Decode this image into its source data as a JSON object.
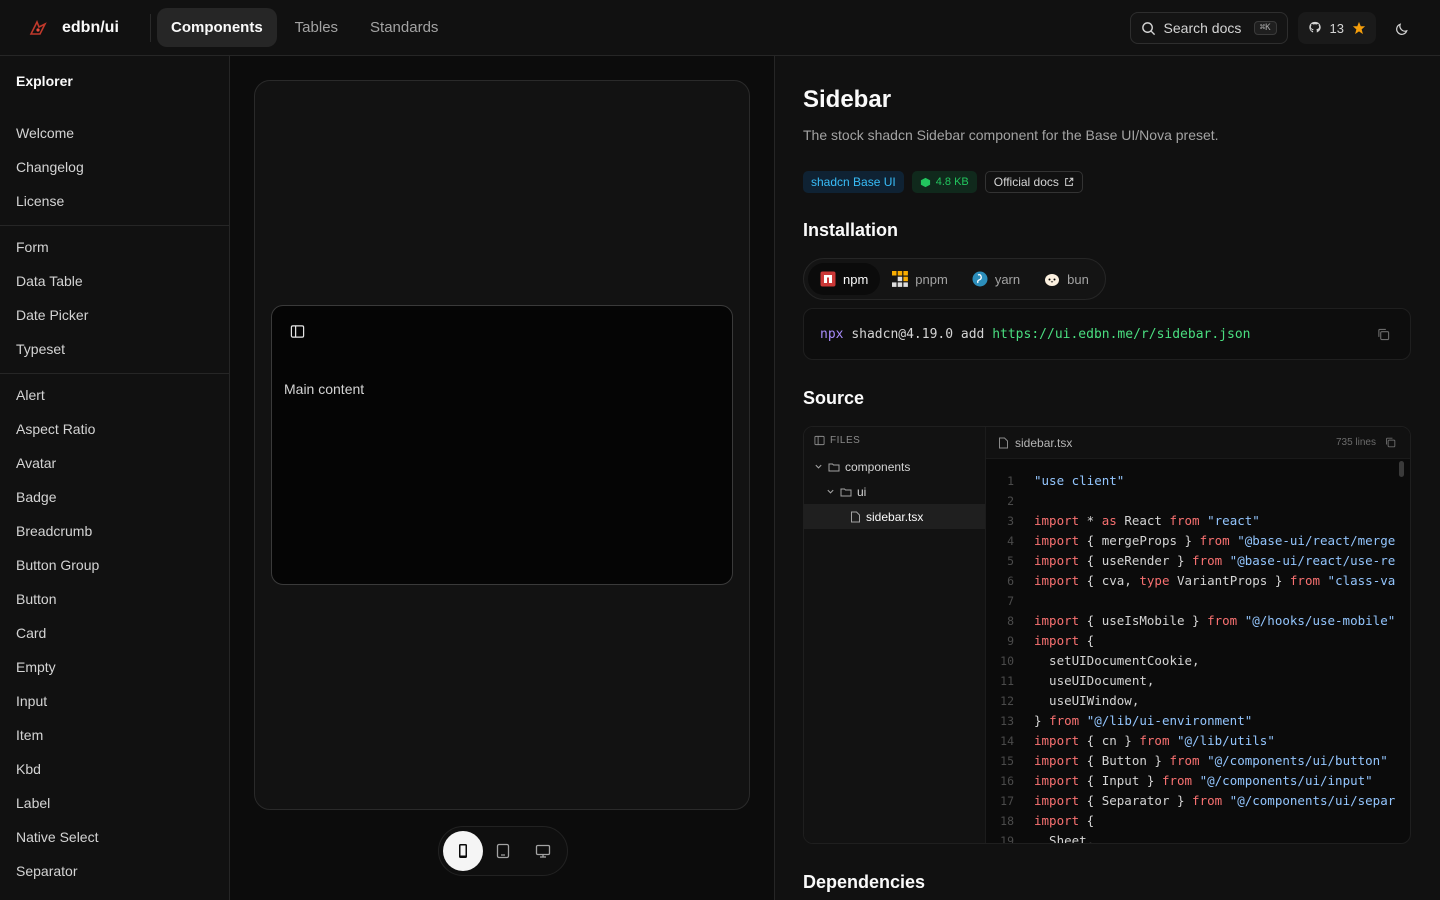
{
  "brand": {
    "name": "edbn/ui"
  },
  "nav": [
    {
      "label": "Components",
      "active": true
    },
    {
      "label": "Tables",
      "active": false
    },
    {
      "label": "Standards",
      "active": false
    }
  ],
  "search": {
    "label": "Search docs",
    "shortcut": "⌘K"
  },
  "github": {
    "stars": "13"
  },
  "sidebar": {
    "title": "Explorer",
    "groups": [
      [
        "Welcome",
        "Changelog",
        "License"
      ],
      [
        "Form",
        "Data Table",
        "Date Picker",
        "Typeset"
      ],
      [
        "Alert",
        "Aspect Ratio",
        "Avatar",
        "Badge",
        "Breadcrumb",
        "Button Group",
        "Button",
        "Card",
        "Empty",
        "Input",
        "Item",
        "Kbd",
        "Label",
        "Native Select",
        "Separator"
      ]
    ]
  },
  "preview": {
    "main_text": "Main content"
  },
  "doc": {
    "title": "Sidebar",
    "description": "The stock shadcn Sidebar component for the Base UI/Nova preset.",
    "badges": {
      "source": "shadcn Base UI",
      "size": "4.8 KB",
      "docs": "Official docs"
    },
    "installation_heading": "Installation",
    "package_managers": [
      "npm",
      "pnpm",
      "yarn",
      "bun"
    ],
    "command": {
      "runner": "npx",
      "pkg": "shadcn@4.19.0 add",
      "url": "https://ui.edbn.me/r/sidebar.json"
    },
    "source_heading": "Source",
    "files_label": "FILES",
    "tree": {
      "folder": "components",
      "subfolder": "ui",
      "file": "sidebar.tsx"
    },
    "open_file": "sidebar.tsx",
    "line_count": "735 lines",
    "code_lines": [
      [
        [
          "s",
          "\"use client\""
        ]
      ],
      [],
      [
        [
          "k",
          "import"
        ],
        [
          "t",
          " * "
        ],
        [
          "k",
          "as"
        ],
        [
          "t",
          " React "
        ],
        [
          "k",
          "from"
        ],
        [
          "s",
          " \"react\""
        ]
      ],
      [
        [
          "k",
          "import"
        ],
        [
          "t",
          " { mergeProps } "
        ],
        [
          "k",
          "from"
        ],
        [
          "s",
          " \"@base-ui/react/merge"
        ]
      ],
      [
        [
          "k",
          "import"
        ],
        [
          "t",
          " { useRender } "
        ],
        [
          "k",
          "from"
        ],
        [
          "s",
          " \"@base-ui/react/use-re"
        ]
      ],
      [
        [
          "k",
          "import"
        ],
        [
          "t",
          " { cva, "
        ],
        [
          "k",
          "type"
        ],
        [
          "t",
          " VariantProps } "
        ],
        [
          "k",
          "from"
        ],
        [
          "s",
          " \"class-va"
        ]
      ],
      [],
      [
        [
          "k",
          "import"
        ],
        [
          "t",
          " { useIsMobile } "
        ],
        [
          "k",
          "from"
        ],
        [
          "s",
          " \"@/hooks/use-mobile\""
        ]
      ],
      [
        [
          "k",
          "import"
        ],
        [
          "t",
          " {"
        ]
      ],
      [
        [
          "t",
          "  setUIDocumentCookie,"
        ]
      ],
      [
        [
          "t",
          "  useUIDocument,"
        ]
      ],
      [
        [
          "t",
          "  useUIWindow,"
        ]
      ],
      [
        [
          "t",
          "} "
        ],
        [
          "k",
          "from"
        ],
        [
          "s",
          " \"@/lib/ui-environment\""
        ]
      ],
      [
        [
          "k",
          "import"
        ],
        [
          "t",
          " { cn } "
        ],
        [
          "k",
          "from"
        ],
        [
          "s",
          " \"@/lib/utils\""
        ]
      ],
      [
        [
          "k",
          "import"
        ],
        [
          "t",
          " { Button } "
        ],
        [
          "k",
          "from"
        ],
        [
          "s",
          " \"@/components/ui/button\""
        ]
      ],
      [
        [
          "k",
          "import"
        ],
        [
          "t",
          " { Input } "
        ],
        [
          "k",
          "from"
        ],
        [
          "s",
          " \"@/components/ui/input\""
        ]
      ],
      [
        [
          "k",
          "import"
        ],
        [
          "t",
          " { Separator } "
        ],
        [
          "k",
          "from"
        ],
        [
          "s",
          " \"@/components/ui/separ"
        ]
      ],
      [
        [
          "k",
          "import"
        ],
        [
          "t",
          " {"
        ]
      ],
      [
        [
          "t",
          "  Sheet,"
        ]
      ]
    ],
    "dependencies_heading": "Dependencies"
  }
}
